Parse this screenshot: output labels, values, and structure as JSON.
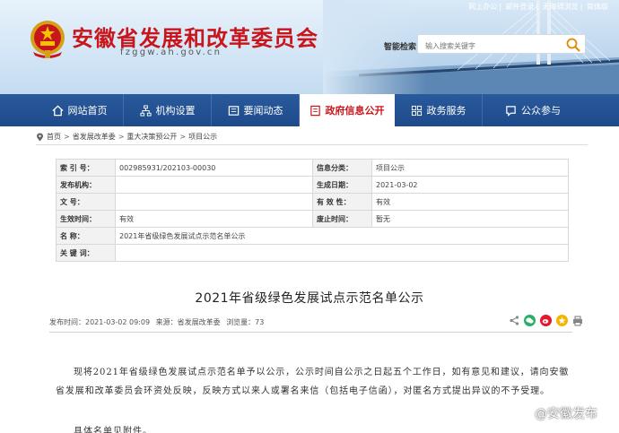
{
  "header": {
    "site_title": "安徽省发展和改革委员会",
    "site_domain": "fzggw.ah.gov.cn",
    "top_links": [
      "网上办公",
      "邮件登录",
      "无障碍浏览",
      "简体版"
    ],
    "search_label": "智能检索",
    "search_placeholder": "输入搜索关键字"
  },
  "nav": {
    "items": [
      {
        "label": "网站首页",
        "icon": "home-icon"
      },
      {
        "label": "机构设置",
        "icon": "org-icon"
      },
      {
        "label": "要闻动态",
        "icon": "news-icon"
      },
      {
        "label": "政府信息公开",
        "icon": "info-icon",
        "active": true
      },
      {
        "label": "政务服务",
        "icon": "service-icon"
      },
      {
        "label": "公众参与",
        "icon": "participation-icon"
      }
    ]
  },
  "breadcrumb": [
    "首页",
    "省发展改革委",
    "重大决策预公开",
    "项目公示"
  ],
  "info_table": {
    "index_label": "索 引 号：",
    "index_value": "002985931/202103-00030",
    "category_label": "信息分类：",
    "category_value": "项目公示",
    "issuer_label": "发布机构：",
    "issuer_value": "",
    "date_label": "生成日期：",
    "date_value": "2021-03-02",
    "docno_label": "文 号：",
    "docno_value": "",
    "validity_label": "有 效 性：",
    "validity_value": "有效",
    "effective_label": "生效时间：",
    "effective_value": "有效",
    "expire_label": "废止时间：",
    "expire_value": "暂无",
    "name_label": "名 称：",
    "name_value": "2021年省级绿色发展试点示范名单公示",
    "keywords_label": "关 键 词：",
    "keywords_value": ""
  },
  "article": {
    "title": "2021年省级绿色发展试点示范名单公示",
    "meta_time": "发布时间：2021-03-02 09:09",
    "meta_source": "来源：省发展改革委",
    "meta_views": "浏览量：73",
    "paragraph": "现将2021年省级绿色发展试点示范名单予以公示，公示时间自公示之日起五个工作日，如有意见和建议，请向安徽省发展和改革委员会环资处反映，反映方式以来人或署名来信（包括电子信函），对匿名方式提出异议的不予受理。",
    "attach_text": "具体名单见附件。"
  },
  "watermark": "@安徽发布",
  "colors": {
    "brand_red": "#c8161d",
    "nav_blue": "#1d4a8a"
  }
}
